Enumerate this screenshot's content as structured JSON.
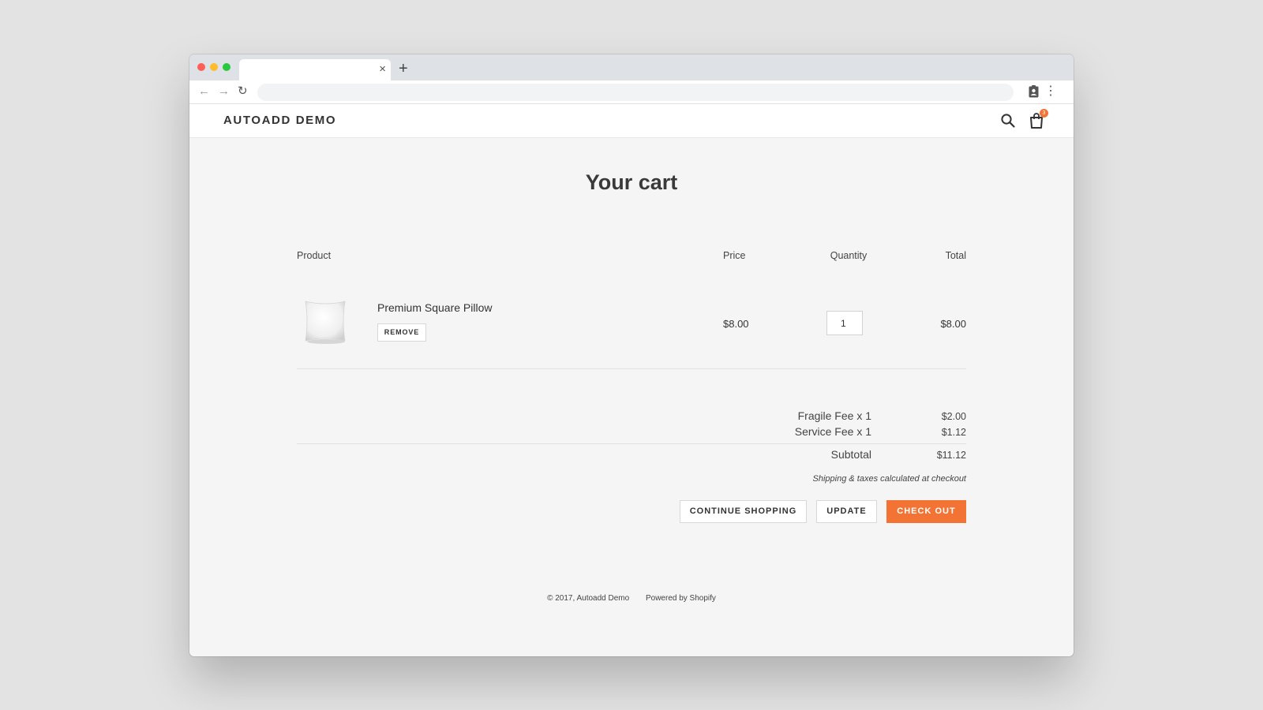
{
  "browser": {
    "tab_close": "×",
    "new_tab": "+",
    "url": ""
  },
  "header": {
    "logo": "AUTOADD DEMO",
    "cart_count": "3"
  },
  "page": {
    "title": "Your cart"
  },
  "table": {
    "headers": {
      "product": "Product",
      "price": "Price",
      "quantity": "Quantity",
      "total": "Total"
    },
    "rows": [
      {
        "name": "Premium Square Pillow",
        "remove_label": "REMOVE",
        "price": "$8.00",
        "quantity": "1",
        "total": "$8.00"
      }
    ]
  },
  "summary": {
    "fees": [
      {
        "label": "Fragile Fee x 1",
        "value": "$2.00"
      },
      {
        "label": "Service Fee x 1",
        "value": "$1.12"
      }
    ],
    "subtotal_label": "Subtotal",
    "subtotal_value": "$11.12",
    "shipping_note": "Shipping & taxes calculated at checkout"
  },
  "buttons": {
    "continue": "CONTINUE SHOPPING",
    "update": "UPDATE",
    "checkout": "CHECK OUT"
  },
  "footer": {
    "copyright": "© 2017, Autoadd Demo",
    "powered": "Powered by Shopify"
  },
  "colors": {
    "accent": "#f27334",
    "page_bg": "#f5f5f5",
    "outer_bg": "#e3e3e3"
  }
}
